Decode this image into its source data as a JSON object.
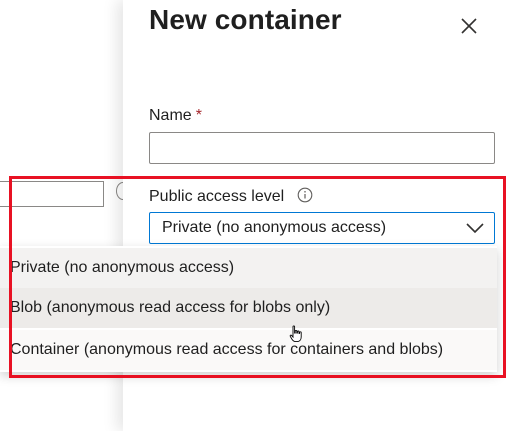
{
  "panel": {
    "title": "New container",
    "close_icon": "close-icon"
  },
  "form": {
    "name": {
      "label": "Name",
      "required_marker": "*",
      "value": ""
    },
    "public_access": {
      "label": "Public access level",
      "info_icon": "info-icon",
      "selected": "Private (no anonymous access)",
      "chevron_icon": "chevron-down-icon",
      "options": [
        "Private (no anonymous access)",
        "Blob (anonymous read access for blobs only)",
        "Container (anonymous read access for containers and blobs)"
      ]
    }
  },
  "colors": {
    "highlight_border": "#e81123",
    "focus_border": "#0078d4",
    "required": "#a4262c"
  },
  "cursor_icon": "hand-pointer-icon"
}
